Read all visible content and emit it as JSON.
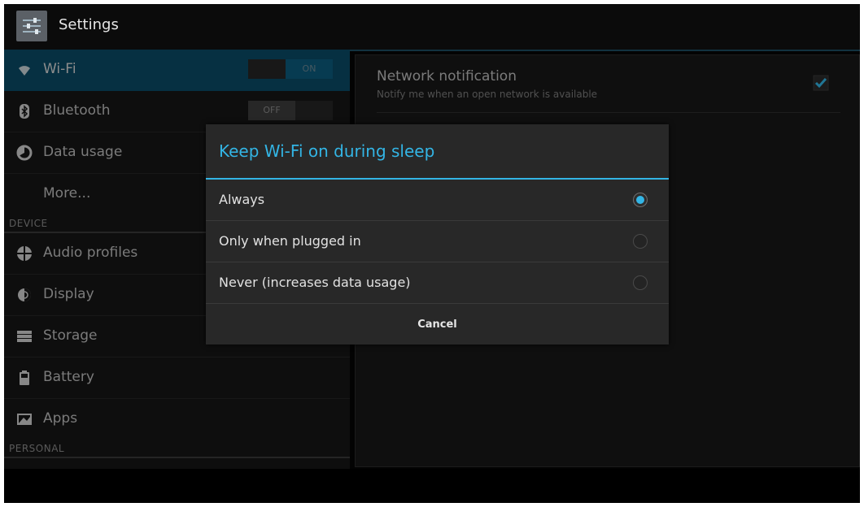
{
  "action_bar": {
    "title": "Settings",
    "icon": "settings-app-icon"
  },
  "sidebar": {
    "wireless_items": [
      {
        "label": "Wi-Fi",
        "icon": "wifi-icon",
        "toggle": "ON",
        "selected": true
      },
      {
        "label": "Bluetooth",
        "icon": "bluetooth-icon",
        "toggle": "OFF",
        "selected": false
      },
      {
        "label": "Data usage",
        "icon": "data-usage-icon"
      },
      {
        "label": "More..."
      }
    ],
    "device_header": "DEVICE",
    "device_items": [
      {
        "label": "Audio profiles",
        "icon": "audio-profiles-icon"
      },
      {
        "label": "Display",
        "icon": "display-icon"
      },
      {
        "label": "Storage",
        "icon": "storage-icon"
      },
      {
        "label": "Battery",
        "icon": "battery-icon"
      },
      {
        "label": "Apps",
        "icon": "apps-icon"
      }
    ],
    "personal_header": "PERSONAL"
  },
  "right_pane": {
    "network_notification": {
      "title": "Network notification",
      "subtitle": "Notify me when an open network is available",
      "checked": true
    }
  },
  "dialog": {
    "title": "Keep Wi-Fi on during sleep",
    "options": [
      {
        "label": "Always",
        "selected": true
      },
      {
        "label": "Only when plugged in",
        "selected": false
      },
      {
        "label": "Never (increases data usage)",
        "selected": false
      }
    ],
    "cancel_label": "Cancel"
  },
  "colors": {
    "accent": "#33b5e5",
    "selected_row": "#0a4a66",
    "background": "#050505"
  }
}
